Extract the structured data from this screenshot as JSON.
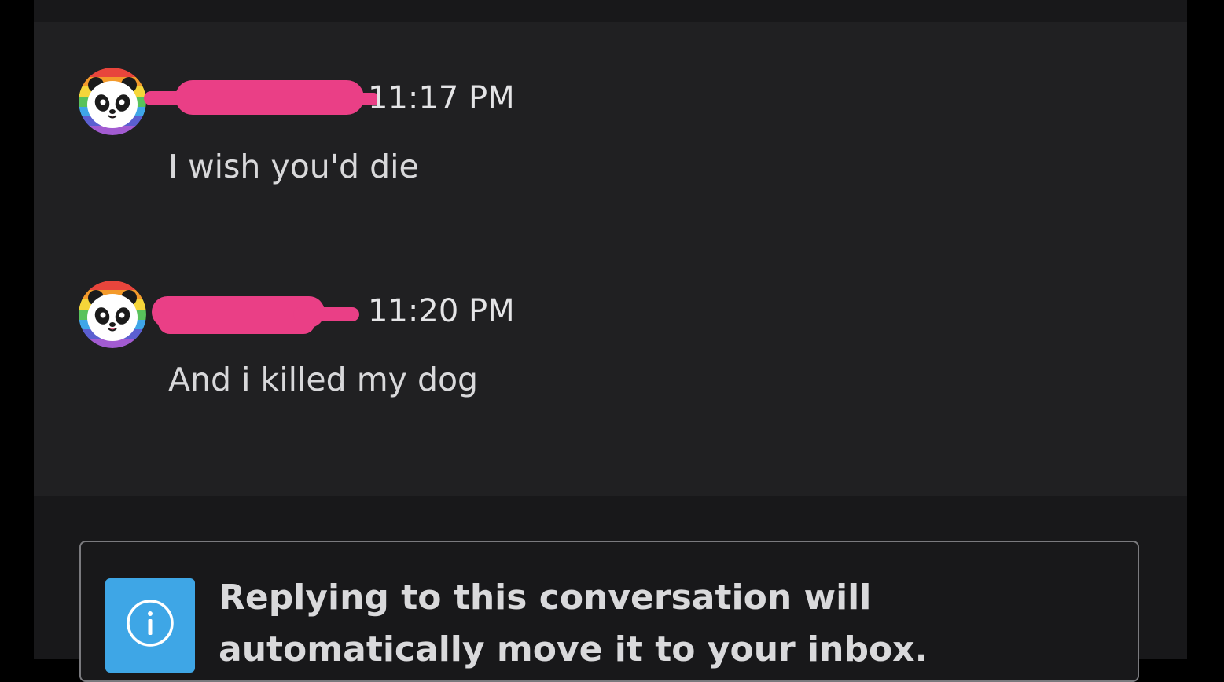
{
  "conversation": {
    "messages": [
      {
        "sender_redacted": true,
        "timestamp": "11:17 PM",
        "text": "I wish you'd die",
        "avatar_icon": "rainbow-panda-avatar-icon"
      },
      {
        "sender_redacted": true,
        "timestamp": "11:20 PM",
        "text": "And i killed my dog",
        "avatar_icon": "rainbow-panda-avatar-icon"
      }
    ]
  },
  "notice": {
    "icon": "info-icon",
    "text": "Replying to this conversation will automatically move it to your inbox."
  },
  "colors": {
    "page_background": "#000000",
    "pane_background": "#202022",
    "redaction": "#ea3f86",
    "info_accent": "#3ea6e6",
    "text_primary": "#e4e4e6"
  }
}
